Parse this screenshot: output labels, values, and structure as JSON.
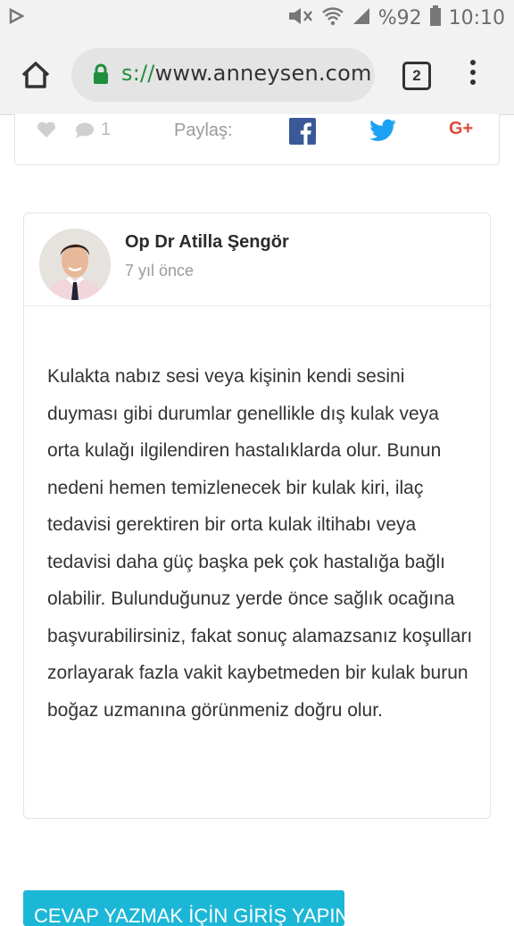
{
  "status_bar": {
    "battery_text": "%92",
    "time": "10:10"
  },
  "browser": {
    "url_scheme": "s://",
    "url_host": "www.anneysen.com",
    "tab_count": "2"
  },
  "share_bar": {
    "comment_count": "1",
    "share_label": "Paylaş:",
    "gplus_label": "G+"
  },
  "answer": {
    "author_name": "Op Dr Atilla Şengör",
    "time_ago": "7 yıl önce",
    "body": "Kulakta nabız sesi veya kişinin kendi sesini duyması gibi durumlar genellikle dış kulak veya orta kulağı ilgilendiren hastalıklarda olur. Bunun nedeni hemen temizlenecek bir kulak kiri, ilaç tedavisi gerektiren bir orta kulak iltihabı veya tedavisi daha güç başka pek çok hastalığa bağlı olabilir. Bulunduğunuz yerde önce sağlık ocağına başvurabilirsiniz, fakat sonuç alamazsanız koşulları zorlayarak fazla vakit kaybetmeden bir kulak burun boğaz uzmanına görünmeniz doğru olur."
  },
  "login_button_label": "CEVAP YAZMAK İÇİN GİRİŞ YAPIN",
  "colors": {
    "facebook": "#3b5998",
    "twitter": "#1da1f2",
    "google_plus": "#dd4b39",
    "login_button": "#1cb7d6",
    "secure_lock": "#1f8e3d"
  }
}
